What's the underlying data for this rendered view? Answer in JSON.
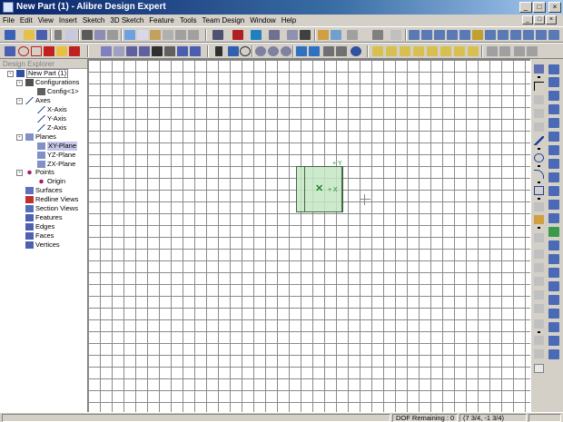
{
  "window": {
    "title": "New Part (1) - Alibre Design Expert",
    "controls": {
      "minimize": "_",
      "maximize": "□",
      "close": "×"
    }
  },
  "menubar": {
    "items": [
      "File",
      "Edit",
      "View",
      "Insert",
      "Sketch",
      "3D Sketch",
      "Feature",
      "Tools",
      "Team Design",
      "Window",
      "Help"
    ]
  },
  "toolbars": {
    "toolbar1_icons": [
      "new-icon",
      "open-icon",
      "save-icon",
      "cut-icon",
      "copy-icon",
      "paste-icon",
      "print-icon",
      "undo-icon",
      "redo-icon",
      "part-icon",
      "assembly-icon",
      "view-icon",
      "render-icon",
      "feature-icons"
    ],
    "toolbar2_icons": [
      "sketch-tools",
      "select-icon",
      "zoom-icon",
      "pan-icon",
      "rotate-icon",
      "view-cube-icons"
    ]
  },
  "explorer": {
    "header": "Design Explorer",
    "tree": [
      {
        "label": "New Part (1)",
        "level": 0,
        "icon": "part-icon",
        "expander": "-",
        "style": "box"
      },
      {
        "label": "Configurations",
        "level": 1,
        "icon": "config-folder-icon",
        "expander": "-"
      },
      {
        "label": "Config<1>",
        "level": 2,
        "icon": "config-icon"
      },
      {
        "label": "Axes",
        "level": 1,
        "icon": "axes-icon",
        "expander": "-"
      },
      {
        "label": "X-Axis",
        "level": 2,
        "icon": "axis-icon"
      },
      {
        "label": "Y-Axis",
        "level": 2,
        "icon": "axis-icon"
      },
      {
        "label": "Z-Axis",
        "level": 2,
        "icon": "axis-icon"
      },
      {
        "label": "Planes",
        "level": 1,
        "icon": "planes-icon",
        "expander": "-"
      },
      {
        "label": "XY-Plane",
        "level": 2,
        "icon": "plane-icon",
        "style": "sel"
      },
      {
        "label": "YZ-Plane",
        "level": 2,
        "icon": "plane-icon"
      },
      {
        "label": "ZX-Plane",
        "level": 2,
        "icon": "plane-icon"
      },
      {
        "label": "Points",
        "level": 1,
        "icon": "points-icon",
        "expander": "-"
      },
      {
        "label": "Origin",
        "level": 2,
        "icon": "origin-icon"
      },
      {
        "label": "Surfaces",
        "level": 1,
        "icon": "surfaces-icon"
      },
      {
        "label": "Redline Views",
        "level": 1,
        "icon": "redline-icon"
      },
      {
        "label": "Section Views",
        "level": 1,
        "icon": "section-icon"
      },
      {
        "label": "Features",
        "level": 1,
        "icon": "features-icon"
      },
      {
        "label": "Edges",
        "level": 1,
        "icon": "edges-icon"
      },
      {
        "label": "Faces",
        "level": 1,
        "icon": "faces-icon"
      },
      {
        "label": "Vertices",
        "level": 1,
        "icon": "vertices-icon"
      }
    ]
  },
  "canvas": {
    "axis_labels": {
      "x": "X",
      "y": "Y"
    }
  },
  "statusbar": {
    "dof": "DOF Remaining : 0",
    "coords": "(7 3/4, -1 3/4)"
  },
  "colors": {
    "titlebar_start": "#0a246a",
    "titlebar_end": "#a6caf0",
    "sketch_plane_fill": "#c4e6c4",
    "origin_green": "#1d8a2d",
    "grid_line": "#8a8a8a"
  }
}
